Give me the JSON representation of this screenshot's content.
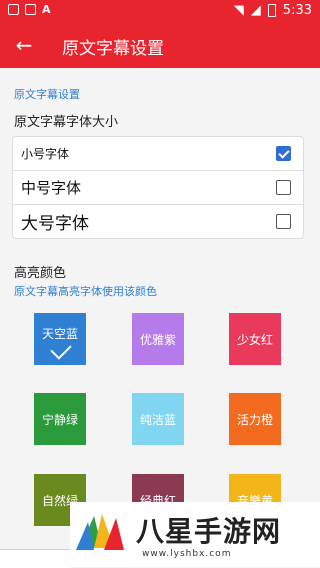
{
  "status_bar": {
    "time": "5:33",
    "icons": [
      "image-icon",
      "photo-icon",
      "a-icon",
      "wifi-icon",
      "signal-icon",
      "battery-icon"
    ]
  },
  "toolbar": {
    "title": "原文字幕设置",
    "back_icon": "arrow-left-icon"
  },
  "settings": {
    "section_title": "原文字幕设置",
    "font_size_label": "原文字幕字体大小",
    "options": [
      {
        "label": "小号字体",
        "checked": true
      },
      {
        "label": "中号字体",
        "checked": false
      },
      {
        "label": "大号字体",
        "checked": false
      }
    ],
    "highlight_label": "高亮颜色",
    "highlight_sub": "原文字幕高亮字体使用该颜色"
  },
  "colors": [
    {
      "label": "天空蓝",
      "color": "#2f7fd2",
      "selected": true
    },
    {
      "label": "优雅紫",
      "color": "#b57bea",
      "selected": false
    },
    {
      "label": "少女红",
      "color": "#ea3a5b",
      "selected": false
    },
    {
      "label": "宁静绿",
      "color": "#2a9a3b",
      "selected": false
    },
    {
      "label": "纯洁蓝",
      "color": "#80d6f1",
      "selected": false
    },
    {
      "label": "活力橙",
      "color": "#f26b1f",
      "selected": false
    },
    {
      "label": "自然绿",
      "color": "#6a8a1f",
      "selected": false
    },
    {
      "label": "经典红",
      "color": "#8c3a52",
      "selected": false
    },
    {
      "label": "音樂黄",
      "color": "#f2b51a",
      "selected": false
    }
  ],
  "watermark": {
    "title": "八星手游网",
    "url": "www.lyshbx.com"
  }
}
